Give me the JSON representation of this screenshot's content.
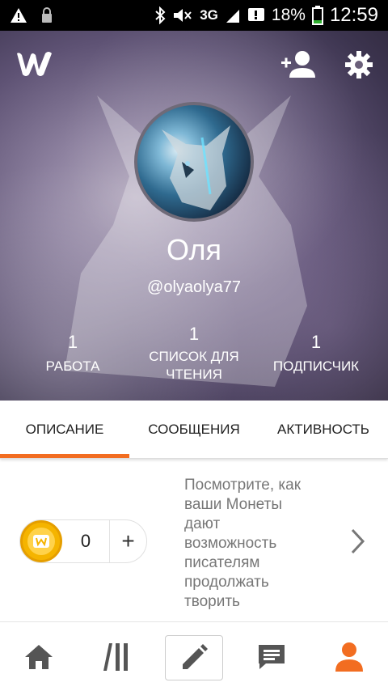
{
  "status_bar": {
    "battery": "18%",
    "time": "12:59",
    "network": "3G",
    "icons": [
      "warning-icon",
      "lock-icon",
      "bluetooth-icon",
      "mute-icon",
      "signal-icon",
      "notification-icon",
      "battery-icon"
    ]
  },
  "header": {
    "logo_icon": "wattpad-w-icon",
    "add_friend_icon": "add-friend-icon",
    "settings_icon": "gear-icon",
    "name": "Оля",
    "username": "@olyaolya77",
    "stats": [
      {
        "value": "1",
        "label": "РАБОТА"
      },
      {
        "value": "1",
        "label_line1": "СПИСОК ДЛЯ",
        "label_line2": "ЧТЕНИЯ"
      },
      {
        "value": "1",
        "label": "ПОДПИСЧИК"
      }
    ]
  },
  "tabs": [
    {
      "label": "ОПИСАНИЕ",
      "active": true
    },
    {
      "label": "СООБЩЕНИЯ",
      "active": false
    },
    {
      "label": "АКТИВНОСТЬ",
      "active": false
    }
  ],
  "coins": {
    "count": "0",
    "plus": "+",
    "text_lines": [
      "Посмотрите, как",
      "ваши Монеты",
      "дают",
      "возможность",
      "писателям",
      "продолжать",
      "творить"
    ]
  },
  "bottom_nav": {
    "items": [
      "home-icon",
      "library-icon",
      "write-icon",
      "messages-icon",
      "profile-icon"
    ],
    "accent": "#f26d21"
  }
}
